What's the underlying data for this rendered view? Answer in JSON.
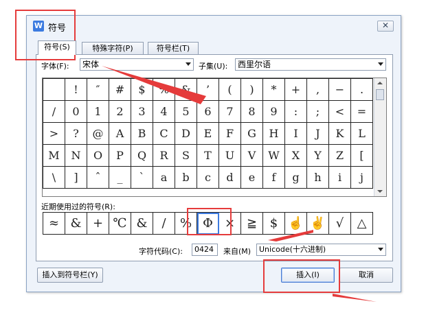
{
  "dialog": {
    "title": "符号",
    "app_icon": "W",
    "close_label": "✕"
  },
  "tabs": [
    {
      "label": "符号(S)",
      "active": true
    },
    {
      "label": "特殊字符(P)",
      "active": false
    },
    {
      "label": "符号栏(T)",
      "active": false
    }
  ],
  "font": {
    "label": "字体(F):",
    "value": "宋体"
  },
  "subset": {
    "label": "子集(U):",
    "value": "西里尔语"
  },
  "symbol_grid": [
    [
      " ",
      "!",
      "″",
      "#",
      "$",
      "%",
      "&",
      "’",
      "(",
      ")",
      "*",
      "+",
      ",",
      "−",
      "."
    ],
    [
      "/",
      "0",
      "1",
      "2",
      "3",
      "4",
      "5",
      "6",
      "7",
      "8",
      "9",
      ":",
      ";",
      "<",
      "="
    ],
    [
      ">",
      "?",
      "@",
      "A",
      "B",
      "C",
      "D",
      "E",
      "F",
      "G",
      "H",
      "I",
      "J",
      "K",
      "L"
    ],
    [
      "M",
      "N",
      "O",
      "P",
      "Q",
      "R",
      "S",
      "T",
      "U",
      "V",
      "W",
      "X",
      "Y",
      "Z",
      "["
    ],
    [
      "\\",
      "]",
      "ˆ",
      "_",
      "ˋ",
      "a",
      "b",
      "c",
      "d",
      "e",
      "f",
      "g",
      "h",
      "i",
      "j"
    ]
  ],
  "recent": {
    "label": "近期使用过的符号(R):",
    "symbols": [
      "≈",
      "&",
      "+",
      "℃",
      "&",
      "/",
      "%",
      "Φ",
      "×",
      "≧",
      "$",
      "☝",
      "✌",
      "√",
      "△"
    ],
    "selected_index": 7
  },
  "char_code": {
    "label": "字符代码(C):",
    "value": "0424"
  },
  "from": {
    "label": "来自(M)",
    "value": "Unicode(十六进制)"
  },
  "buttons": {
    "insert_to_bar": "插入到符号栏(Y)",
    "insert": "插入(I)",
    "cancel": "取消"
  },
  "annotation_color": "#e53b3b",
  "accent_color": "#3c7be0"
}
